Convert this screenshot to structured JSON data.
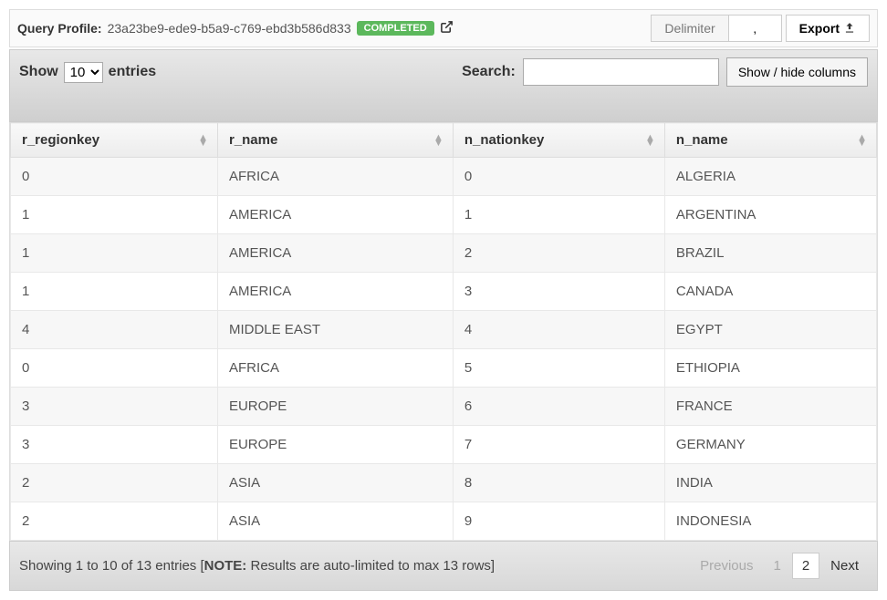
{
  "header": {
    "profile_label": "Query Profile:",
    "profile_id": "23a23be9-ede9-b5a9-c769-ebd3b586d833",
    "status_badge": "COMPLETED",
    "delimiter_label": "Delimiter",
    "delimiter_value": ",",
    "export_label": "Export"
  },
  "controls": {
    "show_label": "Show",
    "entries_label": "entries",
    "entries_value": "10",
    "search_label": "Search:",
    "search_value": "",
    "showhide_label": "Show / hide columns"
  },
  "table": {
    "columns": [
      "r_regionkey",
      "r_name",
      "n_nationkey",
      "n_name"
    ],
    "rows": [
      [
        "0",
        "AFRICA",
        "0",
        "ALGERIA"
      ],
      [
        "1",
        "AMERICA",
        "1",
        "ARGENTINA"
      ],
      [
        "1",
        "AMERICA",
        "2",
        "BRAZIL"
      ],
      [
        "1",
        "AMERICA",
        "3",
        "CANADA"
      ],
      [
        "4",
        "MIDDLE EAST",
        "4",
        "EGYPT"
      ],
      [
        "0",
        "AFRICA",
        "5",
        "ETHIOPIA"
      ],
      [
        "3",
        "EUROPE",
        "6",
        "FRANCE"
      ],
      [
        "3",
        "EUROPE",
        "7",
        "GERMANY"
      ],
      [
        "2",
        "ASIA",
        "8",
        "INDIA"
      ],
      [
        "2",
        "ASIA",
        "9",
        "INDONESIA"
      ]
    ]
  },
  "footer": {
    "info_prefix": "Showing 1 to 10 of 13 entries [",
    "info_note_label": "NOTE:",
    "info_note_text": " Results are auto-limited to max 13 rows]",
    "previous": "Previous",
    "page1": "1",
    "page2": "2",
    "next": "Next"
  }
}
